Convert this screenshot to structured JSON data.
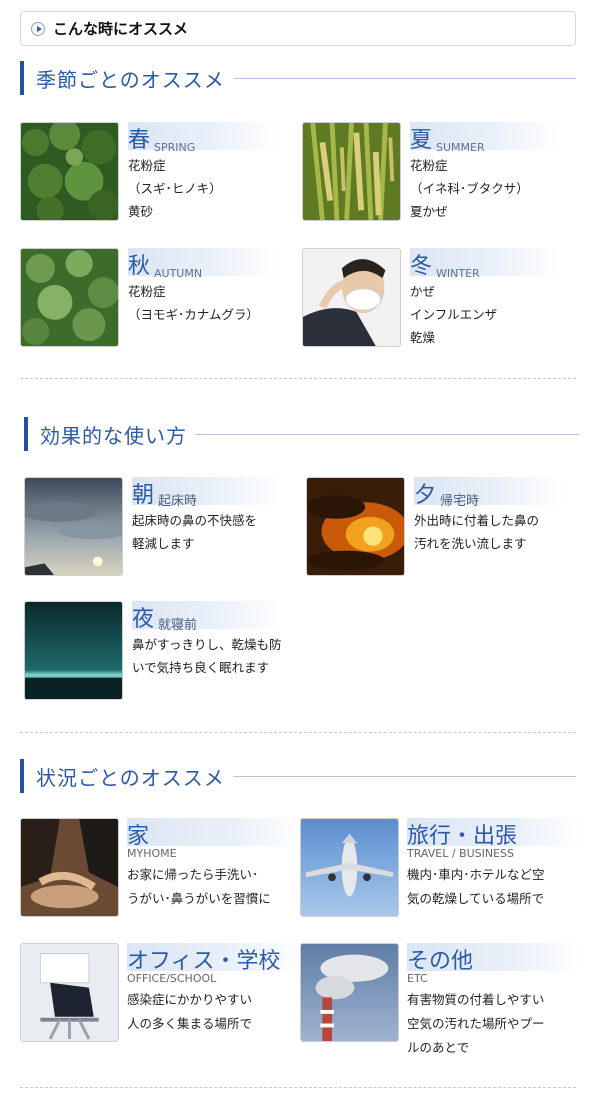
{
  "header": {
    "title": "こんな時にオススメ",
    "icon": "play-circle-icon"
  },
  "colors": {
    "accent": "#2d5aa8",
    "bar": "#2452a0"
  },
  "season_section": {
    "title": "季節ごとのオススメ",
    "items": [
      {
        "title": "春",
        "sub": "SPRING",
        "lines": [
          "花粉症",
          "（スギ･ヒノキ）",
          "黄砂"
        ]
      },
      {
        "title": "夏",
        "sub": "SUMMER",
        "lines": [
          "花粉症",
          "（イネ科･ブタクサ）",
          "夏かぜ"
        ]
      },
      {
        "title": "秋",
        "sub": "AUTUMN",
        "lines": [
          "花粉症",
          "（ヨモギ･カナムグラ）"
        ]
      },
      {
        "title": "冬",
        "sub": "WINTER",
        "lines": [
          "かぜ",
          "インフルエンザ",
          "乾燥"
        ]
      }
    ]
  },
  "usage_section": {
    "title": "効果的な使い方",
    "items": [
      {
        "title": "朝",
        "sub": "起床時",
        "lines": [
          "起床時の鼻の不快感を",
          "軽減します"
        ]
      },
      {
        "title": "夕",
        "sub": "帰宅時",
        "lines": [
          "外出時に付着した鼻の",
          "汚れを洗い流します"
        ]
      },
      {
        "title": "夜",
        "sub": "就寝前",
        "lines": [
          "鼻がすっきりし、乾燥も防",
          "いで気持ち良く眠れます"
        ]
      }
    ]
  },
  "situation_section": {
    "title": "状況ごとのオススメ",
    "items": [
      {
        "title": "家",
        "sub": "MYHOME",
        "lines": [
          "お家に帰ったら手洗い･",
          "うがい･鼻うがいを習慣に"
        ]
      },
      {
        "title": "旅行・出張",
        "sub": "TRAVEL / BUSINESS",
        "lines": [
          "機内･車内･ホテルなど空",
          "気の乾燥している場所で"
        ]
      },
      {
        "title": "オフィス・学校",
        "sub": "OFFICE/SCHOOL",
        "lines": [
          "感染症にかかりやすい",
          "人の多く集まる場所で"
        ]
      },
      {
        "title": "その他",
        "sub": "ETC",
        "lines": [
          "有害物質の付着しやすい",
          "空気の汚れた場所やプー",
          "ルのあとで"
        ]
      }
    ]
  }
}
